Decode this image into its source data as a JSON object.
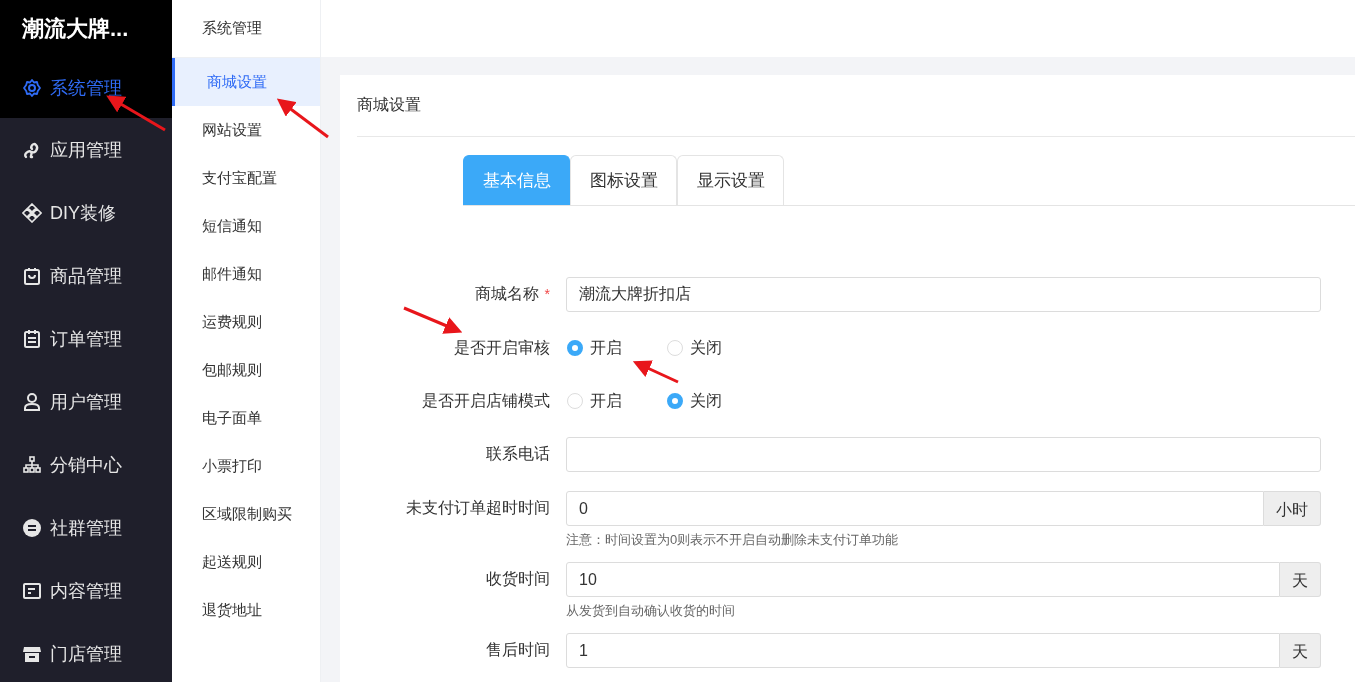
{
  "sidebar": {
    "brand": "潮流大牌...",
    "items": [
      {
        "label": "系统管理",
        "selected": true
      },
      {
        "label": "应用管理",
        "selected": false
      },
      {
        "label": "DIY装修",
        "selected": false
      },
      {
        "label": "商品管理",
        "selected": false
      },
      {
        "label": "订单管理",
        "selected": false
      },
      {
        "label": "用户管理",
        "selected": false
      },
      {
        "label": "分销中心",
        "selected": false
      },
      {
        "label": "社群管理",
        "selected": false
      },
      {
        "label": "内容管理",
        "selected": false
      },
      {
        "label": "门店管理",
        "selected": false
      }
    ]
  },
  "submenu": {
    "title": "系统管理",
    "items": [
      {
        "label": "商城设置",
        "selected": true
      },
      {
        "label": "网站设置",
        "selected": false
      },
      {
        "label": "支付宝配置",
        "selected": false
      },
      {
        "label": "短信通知",
        "selected": false
      },
      {
        "label": "邮件通知",
        "selected": false
      },
      {
        "label": "运费规则",
        "selected": false
      },
      {
        "label": "包邮规则",
        "selected": false
      },
      {
        "label": "电子面单",
        "selected": false
      },
      {
        "label": "小票打印",
        "selected": false
      },
      {
        "label": "区域限制购买",
        "selected": false
      },
      {
        "label": "起送规则",
        "selected": false
      },
      {
        "label": "退货地址",
        "selected": false
      }
    ]
  },
  "panel": {
    "title": "商城设置",
    "tabs": [
      {
        "label": "基本信息",
        "selected": true
      },
      {
        "label": "图标设置",
        "selected": false
      },
      {
        "label": "显示设置",
        "selected": false
      }
    ],
    "fields": [
      {
        "kind": "text",
        "label": "商城名称",
        "required_mark": "*",
        "value": "潮流大牌折扣店"
      },
      {
        "kind": "radio",
        "label": "是否开启审核",
        "options": [
          {
            "label": "开启",
            "selected": true
          },
          {
            "label": "关闭",
            "selected": false
          }
        ]
      },
      {
        "kind": "radio",
        "label": "是否开启店铺模式",
        "options": [
          {
            "label": "开启",
            "selected": false
          },
          {
            "label": "关闭",
            "selected": true
          }
        ]
      },
      {
        "kind": "text",
        "label": "联系电话"
      },
      {
        "kind": "addon",
        "label": "未支付订单超时时间",
        "value": "0",
        "unit": "小时",
        "hint": "注意：时间设置为0则表示不开启自动删除未支付订单功能"
      },
      {
        "kind": "addon",
        "label": "收货时间",
        "value": "10",
        "unit": "天",
        "hint": "从发货到自动确认收货的时间"
      },
      {
        "kind": "addon",
        "label": "售后时间",
        "value": "1",
        "unit": "天"
      }
    ]
  }
}
